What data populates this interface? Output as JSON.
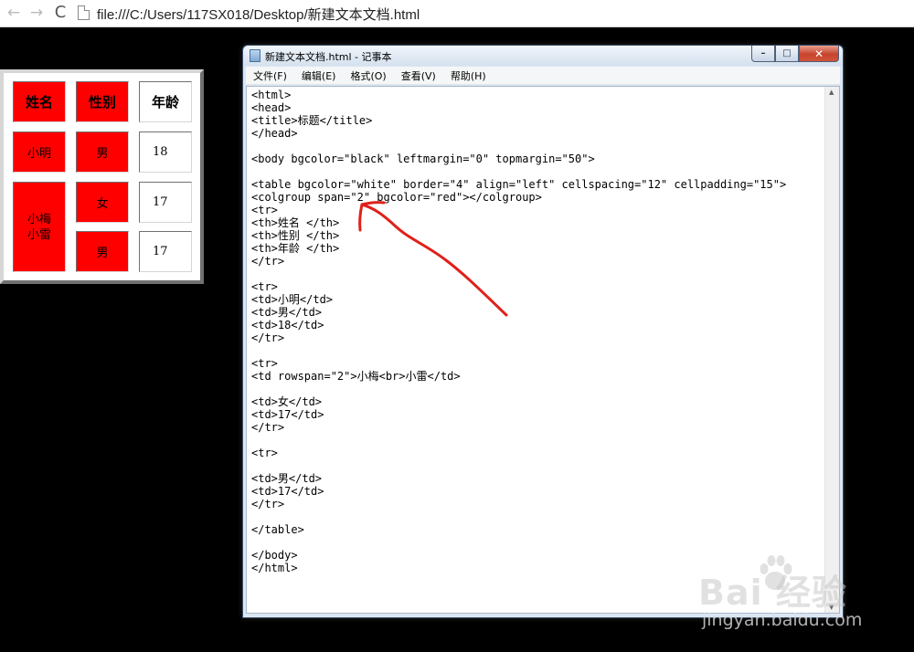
{
  "browser": {
    "back_icon": "←",
    "forward_icon": "→",
    "reload_icon": "C",
    "url": "file:///C:/Users/117SX018/Desktop/新建文本文档.html"
  },
  "table": {
    "headers": [
      "姓名",
      "性别",
      "年龄"
    ],
    "row1": [
      "小明",
      "男",
      "18"
    ],
    "merged_line1": "小梅",
    "merged_line2": "小雷",
    "row2": [
      "女",
      "17"
    ],
    "row3": [
      "男",
      "17"
    ],
    "colors": {
      "colgroup": "#ff0000",
      "table_bg": "#ffffff"
    }
  },
  "notepad": {
    "title": "新建文本文档.html - 记事本",
    "controls": {
      "minimize": "–",
      "maximize": "□",
      "close": "✕"
    },
    "menu": [
      "文件(F)",
      "编辑(E)",
      "格式(O)",
      "查看(V)",
      "帮助(H)"
    ],
    "code": "<html>\n<head>\n<title>标题</title>\n</head>\n\n<body bgcolor=\"black\" leftmargin=\"0\" topmargin=\"50\">\n\n<table bgcolor=\"white\" border=\"4\" align=\"left\" cellspacing=\"12\" cellpadding=\"15\">\n<colgroup span=\"2\" bgcolor=\"red\"></colgroup>\n<tr>\n<th>姓名 </th>\n<th>性别 </th>\n<th>年龄 </th>\n</tr>\n\n<tr>\n<td>小明</td>\n<td>男</td>\n<td>18</td>\n</tr>\n\n<tr>\n<td rowspan=\"2\">小梅<br>小雷</td>\n\n<td>女</td>\n<td>17</td>\n</tr>\n\n<tr>\n\n<td>男</td>\n<td>17</td>\n</tr>\n\n</table>\n\n</body>\n</html>"
  },
  "watermark": {
    "brand": "Bai  经验",
    "url": "jingyan.baidu.com"
  }
}
